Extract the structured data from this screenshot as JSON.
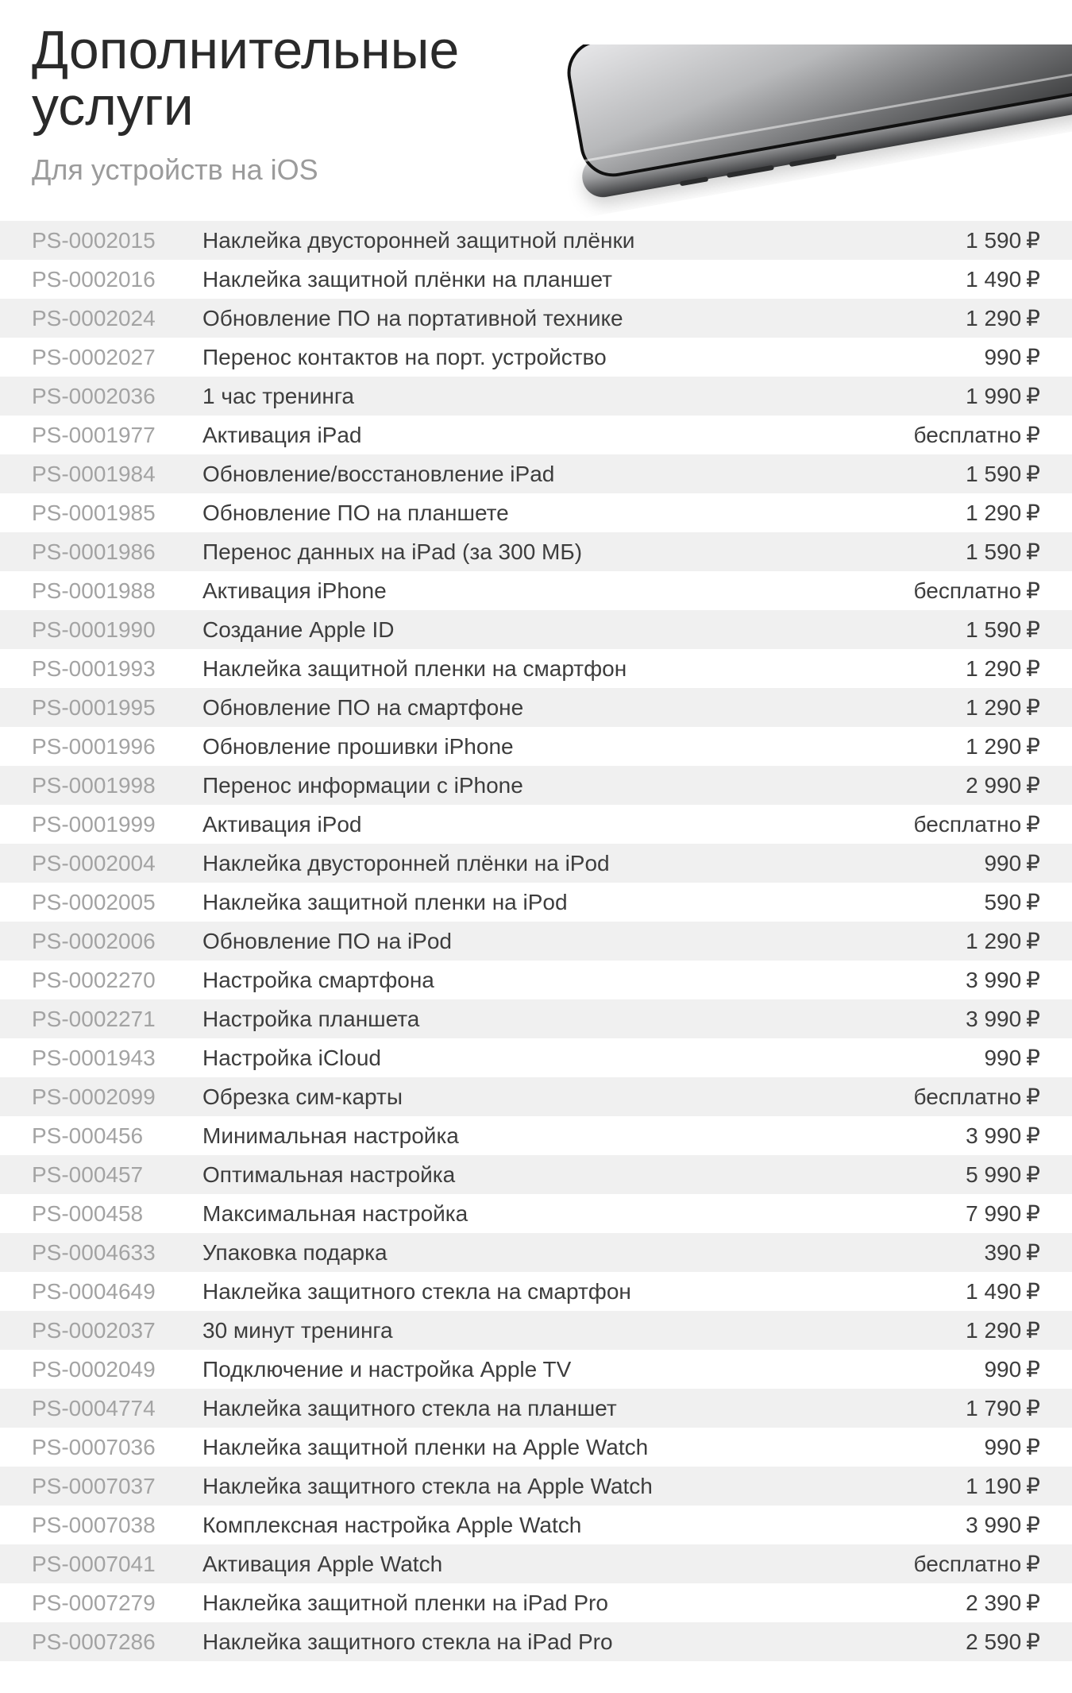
{
  "header": {
    "title": "Дополнительные услуги",
    "subtitle": "Для устройств на iOS"
  },
  "currency_symbol": "₽",
  "services": [
    {
      "sku": "PS-0002015",
      "name": "Наклейка двусторонней защитной плёнки",
      "price": "1 590"
    },
    {
      "sku": "PS-0002016",
      "name": "Наклейка защитной плёнки на планшет",
      "price": "1 490"
    },
    {
      "sku": "PS-0002024",
      "name": "Обновление ПО на портативной технике",
      "price": "1 290"
    },
    {
      "sku": "PS-0002027",
      "name": "Перенос контактов на порт. устройство",
      "price": "990"
    },
    {
      "sku": "PS-0002036",
      "name": "1 час тренинга",
      "price": "1 990"
    },
    {
      "sku": "PS-0001977",
      "name": "Активация iPad",
      "price": "бесплатно"
    },
    {
      "sku": "PS-0001984",
      "name": "Обновление/восстановление iPad",
      "price": "1 590"
    },
    {
      "sku": "PS-0001985",
      "name": "Обновление ПО на планшете",
      "price": "1 290"
    },
    {
      "sku": "PS-0001986",
      "name": "Перенос данных на iPad (за 300 МБ)",
      "price": "1 590"
    },
    {
      "sku": "PS-0001988",
      "name": "Активация iPhone",
      "price": "бесплатно"
    },
    {
      "sku": "PS-0001990",
      "name": "Создание Apple ID",
      "price": "1 590"
    },
    {
      "sku": "PS-0001993",
      "name": "Наклейка защитной пленки на смартфон",
      "price": "1 290"
    },
    {
      "sku": "PS-0001995",
      "name": "Обновление ПО на смартфоне",
      "price": "1 290"
    },
    {
      "sku": "PS-0001996",
      "name": "Обновление прошивки iPhone",
      "price": "1 290"
    },
    {
      "sku": "PS-0001998",
      "name": "Перенос информации с iPhone",
      "price": "2 990"
    },
    {
      "sku": "PS-0001999",
      "name": "Активация iPod",
      "price": "бесплатно"
    },
    {
      "sku": "PS-0002004",
      "name": "Наклейка двусторонней плёнки на iPod",
      "price": "990"
    },
    {
      "sku": "PS-0002005",
      "name": "Наклейка защитной пленки на iPod",
      "price": "590"
    },
    {
      "sku": "PS-0002006",
      "name": "Обновление ПО на iPod",
      "price": "1 290"
    },
    {
      "sku": "PS-0002270",
      "name": "Настройка смартфона",
      "price": "3 990"
    },
    {
      "sku": "PS-0002271",
      "name": "Настройка планшета",
      "price": "3 990"
    },
    {
      "sku": "PS-0001943",
      "name": "Настройка iCloud",
      "price": "990"
    },
    {
      "sku": "PS-0002099",
      "name": "Обрезка сим-карты",
      "price": "бесплатно"
    },
    {
      "sku": "PS-000456",
      "name": "Минимальная настройка",
      "price": "3 990"
    },
    {
      "sku": "PS-000457",
      "name": "Оптимальная настройка",
      "price": "5 990"
    },
    {
      "sku": "PS-000458",
      "name": "Максимальная настройка",
      "price": "7 990"
    },
    {
      "sku": "PS-0004633",
      "name": "Упаковка подарка",
      "price": "390"
    },
    {
      "sku": "PS-0004649",
      "name": "Наклейка защитного стекла на смартфон",
      "price": "1 490"
    },
    {
      "sku": "PS-0002037",
      "name": "30 минут тренинга",
      "price": "1 290"
    },
    {
      "sku": "PS-0002049",
      "name": "Подключение и настройка Apple TV",
      "price": "990"
    },
    {
      "sku": "PS-0004774",
      "name": "Наклейка защитного стекла на планшет",
      "price": "1 790"
    },
    {
      "sku": "PS-0007036",
      "name": "Наклейка защитной пленки на Apple Watch",
      "price": "990"
    },
    {
      "sku": "PS-0007037",
      "name": "Наклейка защитного стекла на Apple Watch",
      "price": "1 190"
    },
    {
      "sku": "PS-0007038",
      "name": "Комплексная настройка  Apple Watch",
      "price": "3 990"
    },
    {
      "sku": "PS-0007041",
      "name": "Активация Apple Watch",
      "price": "бесплатно"
    },
    {
      "sku": "PS-0007279",
      "name": "Наклейка защитной пленки на iPad Pro",
      "price": "2 390"
    },
    {
      "sku": "PS-0007286",
      "name": "Наклейка защитного стекла на iPad Pro",
      "price": "2 590"
    }
  ]
}
